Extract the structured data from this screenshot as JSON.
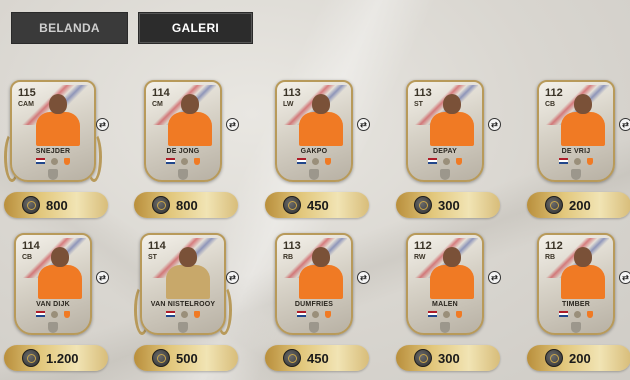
{
  "tabs": [
    {
      "label": "BELANDA",
      "active": false
    },
    {
      "label": "GALERI",
      "active": true
    }
  ],
  "cards": [
    {
      "rating": "115",
      "position": "CAM",
      "name": "SNEJDER",
      "price": "800",
      "laurel": true,
      "kit": "orange"
    },
    {
      "rating": "114",
      "position": "CM",
      "name": "DE JONG",
      "price": "800",
      "laurel": false,
      "kit": "orange"
    },
    {
      "rating": "113",
      "position": "LW",
      "name": "GAKPO",
      "price": "450",
      "laurel": false,
      "kit": "orange"
    },
    {
      "rating": "113",
      "position": "ST",
      "name": "DEPAY",
      "price": "300",
      "laurel": false,
      "kit": "orange"
    },
    {
      "rating": "112",
      "position": "CB",
      "name": "DE VRIJ",
      "price": "200",
      "laurel": false,
      "kit": "orange"
    },
    {
      "rating": "114",
      "position": "CB",
      "name": "VAN DIJK",
      "price": "1.200",
      "laurel": false,
      "kit": "orange"
    },
    {
      "rating": "114",
      "position": "ST",
      "name": "VAN NISTELROOY",
      "price": "500",
      "laurel": true,
      "kit": "gold"
    },
    {
      "rating": "113",
      "position": "RB",
      "name": "DUMFRIES",
      "price": "450",
      "laurel": false,
      "kit": "orange"
    },
    {
      "rating": "112",
      "position": "RW",
      "name": "MALEN",
      "price": "300",
      "laurel": false,
      "kit": "orange"
    },
    {
      "rating": "112",
      "position": "RB",
      "name": "TIMBER",
      "price": "200",
      "laurel": false,
      "kit": "orange"
    }
  ],
  "icons": {
    "swap": "swap-icon",
    "coin": "coin-icon",
    "flag": "netherlands-flag-icon",
    "federation": "knvb-logo-icon"
  }
}
